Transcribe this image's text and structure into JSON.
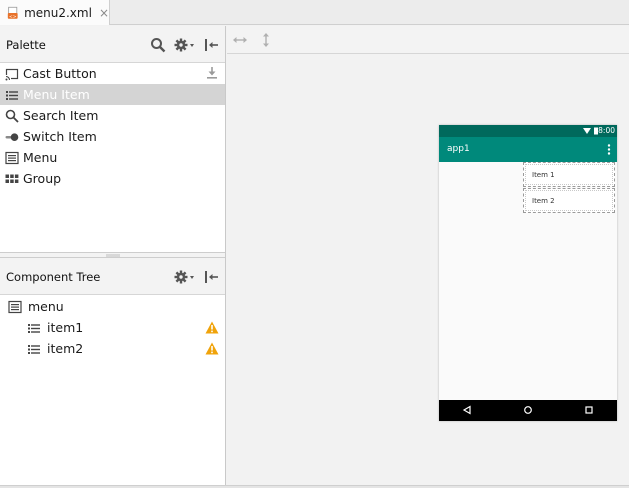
{
  "tabs": [
    {
      "label": "menu2.xml",
      "close": "×"
    }
  ],
  "palette": {
    "title": "Palette",
    "items": [
      {
        "label": "Cast Button",
        "icon": "cast-icon"
      },
      {
        "label": "Menu Item",
        "icon": "list-icon",
        "selected": true
      },
      {
        "label": "Search Item",
        "icon": "search-icon"
      },
      {
        "label": "Switch Item",
        "icon": "switch-icon"
      },
      {
        "label": "Menu",
        "icon": "menu-icon"
      },
      {
        "label": "Group",
        "icon": "group-icon"
      }
    ]
  },
  "component_tree": {
    "title": "Component Tree",
    "items": [
      {
        "label": "menu",
        "icon": "menu-icon",
        "level": 0,
        "warning": false
      },
      {
        "label": "item1",
        "icon": "list-icon",
        "level": 1,
        "warning": true
      },
      {
        "label": "item2",
        "icon": "list-icon",
        "level": 1,
        "warning": true
      }
    ]
  },
  "preview": {
    "clock": "8:00",
    "app_title": "app1",
    "popup_items": [
      "Item 1",
      "Item 2"
    ]
  },
  "colors": {
    "status_bar": "#00695c",
    "app_bar": "#00897b",
    "selection": "#d4d4d4",
    "warning": "#f0a30a"
  }
}
